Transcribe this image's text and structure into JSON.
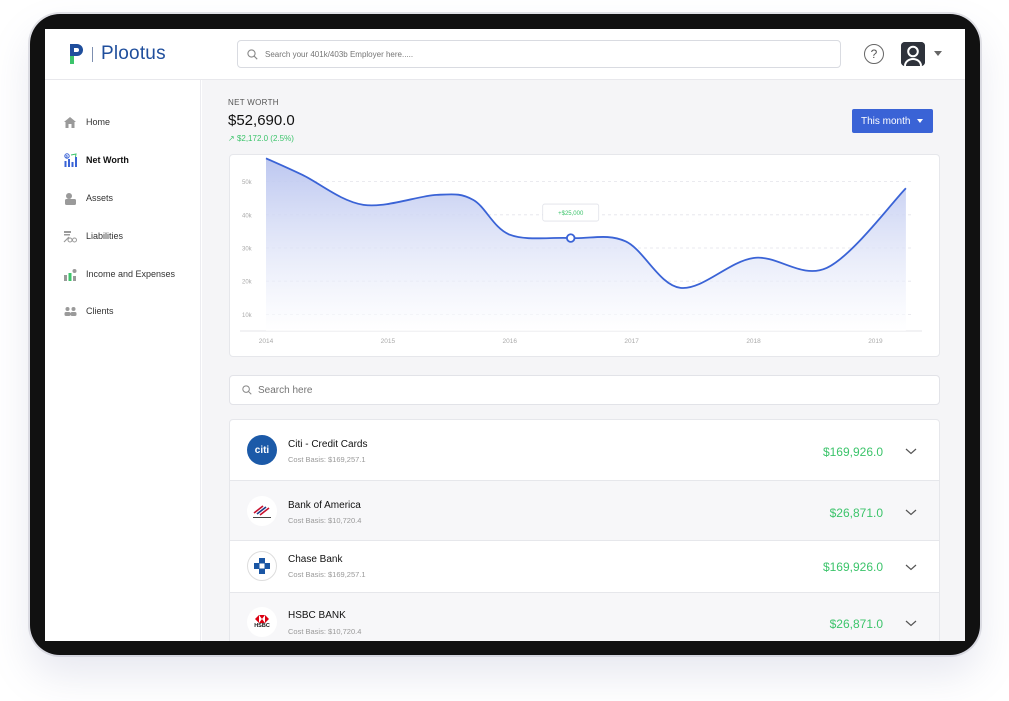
{
  "app": {
    "name": "Plootus",
    "search_placeholder": "Search your 401k/403b Employer here.....",
    "help_label": "?"
  },
  "sidebar": {
    "items": [
      {
        "label": "Home",
        "icon": "home-icon",
        "active": false
      },
      {
        "label": "Net Worth",
        "icon": "net-worth-icon",
        "active": true
      },
      {
        "label": "Assets",
        "icon": "assets-icon",
        "active": false
      },
      {
        "label": "Liabilities",
        "icon": "liabilities-icon",
        "active": false
      },
      {
        "label": "Income and Expenses",
        "icon": "income-expenses-icon",
        "active": false
      },
      {
        "label": "Clients",
        "icon": "clients-icon",
        "active": false
      }
    ]
  },
  "summary": {
    "label": "NET WORTH",
    "value": "$52,690.0",
    "change": "$2,172.0 (2.5%)",
    "period_button": "This month"
  },
  "chart_data": {
    "type": "area",
    "x": [
      2014.0,
      2014.3,
      2014.8,
      2015.4,
      2015.7,
      2016.0,
      2016.5,
      2016.95,
      2017.4,
      2018.0,
      2018.6,
      2019.25
    ],
    "values": [
      57000,
      52000,
      43000,
      46000,
      44500,
      34000,
      33000,
      32000,
      18000,
      27000,
      24000,
      48000
    ],
    "xticks": [
      "2014",
      "2015",
      "2016",
      "2017",
      "2018",
      "2019"
    ],
    "ytick_labels": [
      "10k",
      "20k",
      "30k",
      "40k",
      "50k"
    ],
    "yticks": [
      10000,
      20000,
      30000,
      40000,
      50000
    ],
    "xlim": [
      2014.0,
      2019.3
    ],
    "ylim": [
      5000,
      55000
    ],
    "grid": true,
    "line_color": "#3a63d6",
    "fill_color_top": "#b9c4ef",
    "fill_color_bottom": "#ffffff",
    "marker": {
      "x": 2016.5,
      "y": 33000,
      "label": "+$25,000"
    }
  },
  "list": {
    "search_placeholder": "Search here",
    "accounts": [
      {
        "name": "Citi - Credit Cards",
        "basis": "Cost Basis: $169,257.1",
        "amount": "$169,926.0",
        "logo_text": "citi",
        "logo": "citi-logo"
      },
      {
        "name": "Bank of America",
        "basis": "Cost Basis: $10,720.4",
        "amount": "$26,871.0",
        "logo_text": "",
        "logo": "bank-of-america-logo"
      },
      {
        "name": "Chase Bank",
        "basis": "Cost Basis: $169,257.1",
        "amount": "$169,926.0",
        "logo_text": "",
        "logo": "chase-logo"
      },
      {
        "name": "HSBC BANK",
        "basis": "Cost Basis: $10,720.4",
        "amount": "$26,871.0",
        "logo_text": "HSBC",
        "logo": "hsbc-logo"
      }
    ]
  },
  "colors": {
    "brand": "#1f4e9c",
    "accent": "#3a63d6",
    "positive": "#3cc46b"
  }
}
